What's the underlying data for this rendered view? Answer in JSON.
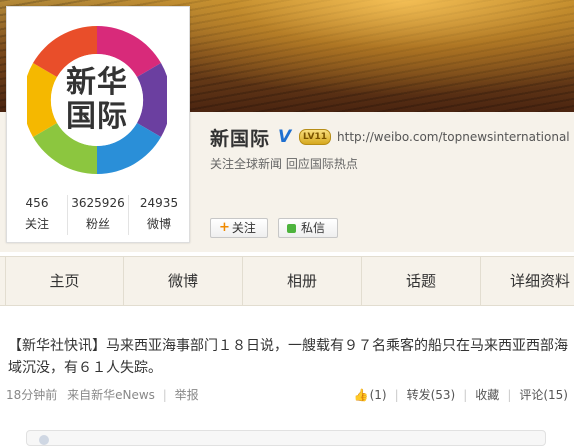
{
  "profile": {
    "logo_line1": "新华",
    "logo_line2": "国际",
    "name": "新国际",
    "verified_icon": "verified-v-icon",
    "level_badge": "LV11",
    "url": "http://weibo.com/topnewsinternational",
    "description": "关注全球新闻 回应国际热点"
  },
  "stats": [
    {
      "value": "456",
      "label": "关注"
    },
    {
      "value": "3625926",
      "label": "粉丝"
    },
    {
      "value": "24935",
      "label": "微博"
    }
  ],
  "buttons": {
    "follow": "关注",
    "message": "私信"
  },
  "nav": {
    "tabs": [
      "主页",
      "微博",
      "相册",
      "话题",
      "详细资料"
    ]
  },
  "post": {
    "text": "【新华社快讯】马来西亚海事部门１８日说，一艘载有９７名乘客的船只在马来西亚西部海域沉没，有６１人失踪。",
    "time": "18分钟前",
    "source": "来自新华eNews",
    "report": "举报",
    "like": "(1)",
    "repost": "转发(53)",
    "favorite": "收藏",
    "comment": "评论(15)"
  },
  "colors": {
    "accent": "#1e6fd0",
    "follow_plus": "#f08a00",
    "nav_bg": "#f6f2ea"
  }
}
